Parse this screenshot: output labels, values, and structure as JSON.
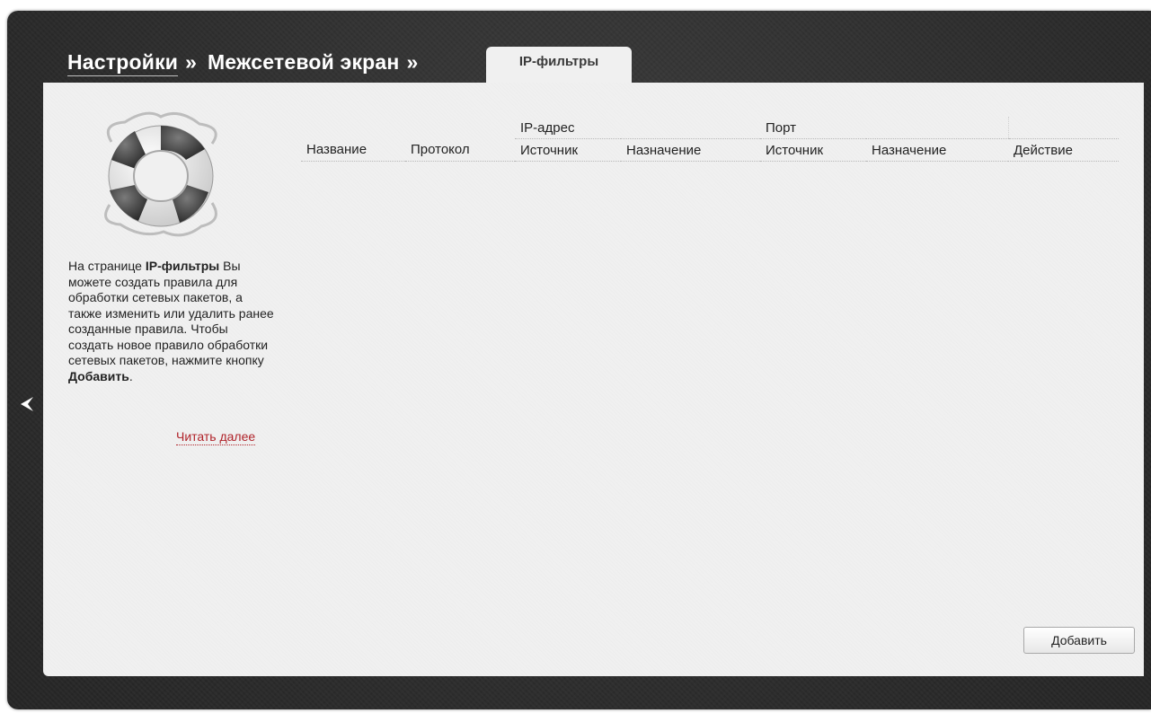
{
  "breadcrumb": {
    "settings": "Настройки",
    "firewall": "Межсетевой экран",
    "separator": "»",
    "current": "IP-фильтры"
  },
  "help": {
    "prefix": "На странице ",
    "page_name": "IP-фильтры",
    "body": " Вы можете создать правила для обработки сетевых пакетов, а также изменить или удалить ранее созданные правила. Чтобы создать новое правило обработки сетевых пакетов, нажмите кнопку ",
    "button_name": "Добавить",
    "suffix": ".",
    "read_more": "Читать далее"
  },
  "table": {
    "group_ip": "IP-адрес",
    "group_port": "Порт",
    "columns": [
      "Название",
      "Протокол",
      "Источник",
      "Назначение",
      "Источник",
      "Назначение",
      "Действие"
    ],
    "rows": []
  },
  "actions": {
    "add_label": "Добавить"
  },
  "icons": {
    "back": "chevron-left-icon",
    "help_illustration": "lifebuoy-icon"
  },
  "colors": {
    "frame": "#2e2e2e",
    "panel": "#f0f0f0",
    "link": "#b0232a"
  }
}
